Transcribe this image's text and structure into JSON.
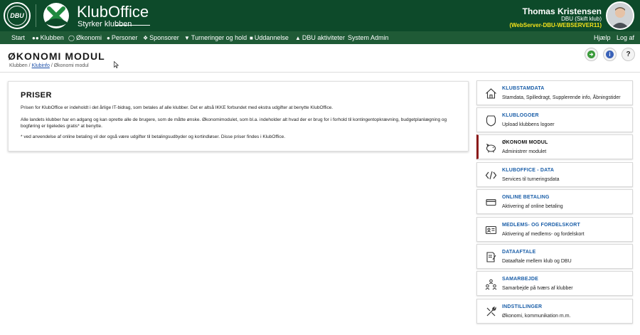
{
  "header": {
    "dbu_logo_text": "DBU",
    "brand_name": "KlubOffice",
    "brand_tagline": "Styrker klubben",
    "user_name": "Thomas Kristensen",
    "user_club": "DBU (Skift klub)",
    "user_server": "(WebServer-DBU-WEBSERVER11)"
  },
  "nav": {
    "items": [
      {
        "label": "Start",
        "icon": ""
      },
      {
        "label": "Klubben",
        "icon": "users-icon"
      },
      {
        "label": "Økonomi",
        "icon": "coin-icon"
      },
      {
        "label": "Personer",
        "icon": "person-icon"
      },
      {
        "label": "Sponsorer",
        "icon": "handshake-icon"
      },
      {
        "label": "Turneringer og hold",
        "icon": "trophy-icon"
      },
      {
        "label": "Uddannelse",
        "icon": "book-icon"
      },
      {
        "label": "DBU aktiviteter",
        "icon": "graduation-icon"
      },
      {
        "label": "System Admin",
        "icon": ""
      }
    ],
    "help": "Hjælp",
    "logout": "Log af"
  },
  "page": {
    "title": "ØKONOMI MODUL",
    "breadcrumb_1": "Klubben",
    "breadcrumb_2": "Klubinfo",
    "breadcrumb_3": "Økonomi modul",
    "sep": "/"
  },
  "buttons": {
    "help_glyph": "?",
    "info_glyph": "i"
  },
  "main": {
    "heading": "PRISER",
    "p1": "Prisen for KlubOffice er indeholdt i det årlige IT-bidrag, som betales af alle klubber. Det er altså IKKE forbundet med ekstra udgifter at benytte KlubOffice.",
    "p2": "Alle landets klubber har en adgang og kan oprette alle de brugere, som de måtte ønske. Økonomimodulet, som bl.a. indeholder alt hvad der er brug for i forhold til kontingentopkrævning, budgetplanlægning og bogføring er ligeledes gratis* at benytte.",
    "p3": "* ved anvendelse af online betaling vil der også være udgifter til betalingsudbyder og kortindløser. Disse priser findes i KlubOffice."
  },
  "sidebar": {
    "items": [
      {
        "title": "KLUBSTAMDATA",
        "sub": "Stamdata, Spilledragt, Supplerende info, Åbningstider",
        "icon": "house-icon"
      },
      {
        "title": "KLUBLOGOER",
        "sub": "Upload klubbens logoer",
        "icon": "shield-icon"
      },
      {
        "title": "ØKONOMI MODUL",
        "sub": "Administrer modulet",
        "icon": "piggy-bank-icon"
      },
      {
        "title": "KLUBOFFICE - DATA",
        "sub": "Services til turneringsdata",
        "icon": "code-icon"
      },
      {
        "title": "ONLINE BETALING",
        "sub": "Aktivering af online betaling",
        "icon": "credit-card-icon"
      },
      {
        "title": "MEDLEMS- OG FORDELSKORT",
        "sub": "Aktivering af medlems- og fordelskort",
        "icon": "id-card-icon"
      },
      {
        "title": "DATAAFTALE",
        "sub": "Dataaftale mellem klub og DBU",
        "icon": "document-sign-icon"
      },
      {
        "title": "SAMARBEJDE",
        "sub": "Samarbejde på tværs af klubber",
        "icon": "team-icon"
      },
      {
        "title": "INDSTILLINGER",
        "sub": "Økonomi, kommunikation m.m.",
        "icon": "tools-icon"
      }
    ]
  },
  "colors": {
    "header_bg": "#0d4a2a",
    "nav_bg": "#1f5a36",
    "link_blue": "#1a5ea8",
    "active_marker": "#8b1a1a",
    "server_text": "#f5e21a"
  }
}
